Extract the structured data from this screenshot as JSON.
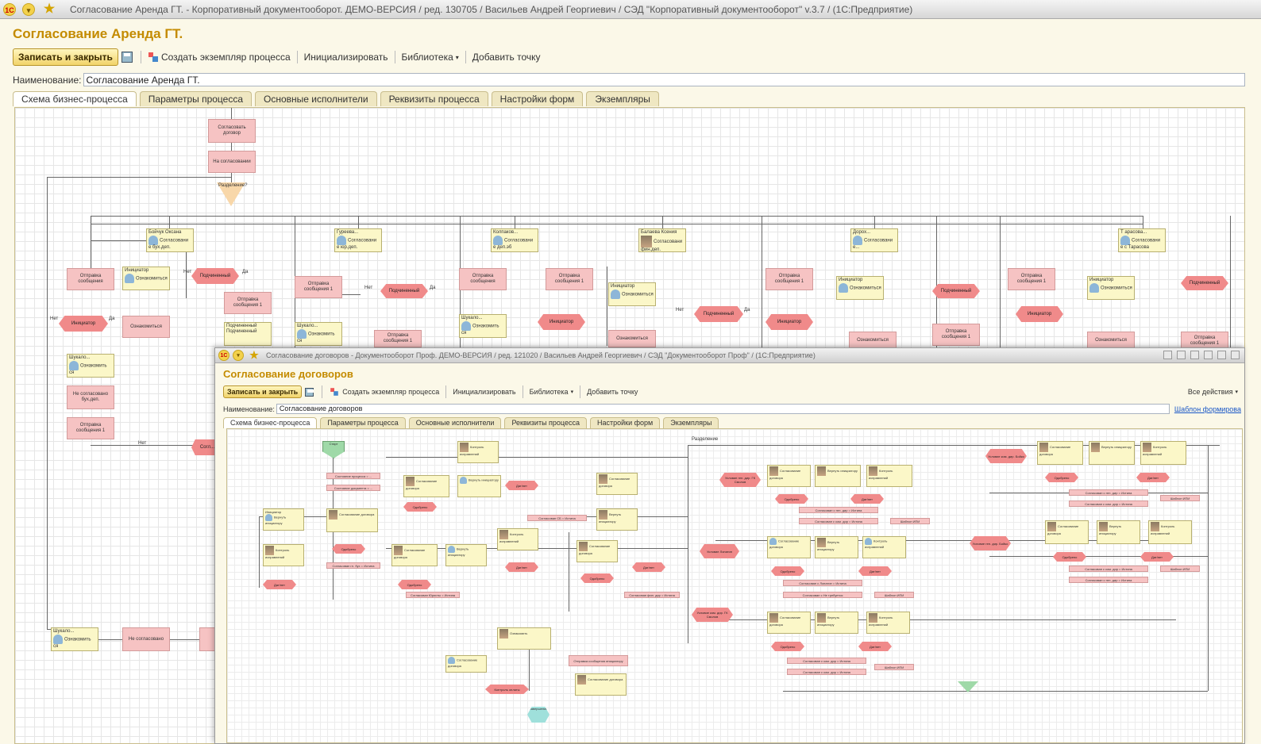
{
  "window": {
    "title": "Согласование Аренда ГТ. - Корпоративный документооборот. ДЕМО-ВЕРСИЯ / ред. 130705 /  Васильев Андрей Георгиевич  /  СЭД \"Корпоративный документооборот\" v.3.7 /  (1С:Предприятие)"
  },
  "form": {
    "title": "Согласование Аренда ГТ.",
    "toolbar": {
      "save_close": "Записать и закрыть",
      "create_instance": "Создать экземпляр процесса",
      "initialize": "Инициализировать",
      "library": "Библиотека",
      "add_point": "Добавить точку"
    },
    "name_label": "Наименование:",
    "name_value": "Согласование Аренда ГТ.",
    "tabs": [
      "Схема бизнес-процесса",
      "Параметры процесса",
      "Основные исполнители",
      "Реквизиты процесса",
      "Настройки форм",
      "Экземпляры"
    ],
    "diagram": {
      "n_top_send": "Согласовать договор",
      "n_on_approval": "На согласовании",
      "n_split": "Разделение?",
      "tasks": [
        "Бойчук Оксана",
        "Гуреева...",
        "Колпаков...",
        "Балаева Ксения",
        "Дорох...",
        "Т арасова...",
        "Инициатор",
        "Шукалова..."
      ],
      "task_sub": [
        "Согласовани е бух.деп.",
        "Согласовани е юр.деп.",
        "Согласовани е деп.эб",
        "Согласовани фин.деп.",
        "Согласовани е...",
        "Согласовани е с Тарасова"
      ],
      "send_msg": "Отправка сообщения",
      "send_msg1": "Отправка сообщения 1",
      "subordinate": "Подчиненный",
      "initiator": "Инициатор",
      "acquaint": "Ознакомиться",
      "yes": "Да",
      "no": "Нет",
      "not_approved_buh": "Не согласовано бух.деп.",
      "not_approved": "Не согласовано",
      "acquaint_bottom": "Ознакомить ся",
      "shukalo": "Шукало...",
      "sog": "Согл..."
    }
  },
  "inner": {
    "title": "Согласование договоров - Документооборот Проф. ДЕМО-ВЕРСИЯ / ред. 121020 /  Васильев Андрей Георгиевич  /  СЭД \"Документооборот Проф\" /  (1С:Предприятие)",
    "form_title": "Согласование договоров",
    "toolbar": {
      "save_close": "Записать и закрыть",
      "create_instance": "Создать экземпляр процесса",
      "initialize": "Инициализировать",
      "library": "Библиотека",
      "add_point": "Добавить точку",
      "all_actions": "Все действия"
    },
    "name_label": "Наименование:",
    "name_value": "Согласование договоров",
    "template_link": "Шаблон формирова",
    "tabs": [
      "Схема бизнес-процесса",
      "Параметры процесса",
      "Основные исполнители",
      "Реквизиты процесса",
      "Настройки форм",
      "Экземпляры"
    ],
    "diagram": {
      "start": "Старт",
      "end": "Завершение",
      "split": "Разделение",
      "state1": "Состояние процесса = ...",
      "state2": "Состояние документа = ...",
      "approved": "Одобрено",
      "rejected": "Дат/нет",
      "approve_sb": "Согласован СБ = Истина",
      "approve_buh": "Согласован гл. бух = Истина",
      "approve_ur": "Согласован Юристы = Истина",
      "approve_fin": "Согласован фин. дир = Истина",
      "approve_gen": "Согласован с ген. дир = Истина",
      "approve_com": "Согласован с ком. дир = Истина",
      "approve_ipp": "Согласован с Лопатин = Истина",
      "approve_np": "Согласован с Не требуется",
      "vip": "Шаблон ИПИ",
      "initiator": "Инициатор",
      "familiar": "Ознакомить",
      "control": "Контроль оплаты",
      "send_init": "Отправка сообщения инициатору",
      "cond_smolov": "Условие ген. дир. ГК Смолов",
      "cond_lopatin": "Условие Лопатин",
      "cond_kom": "Условие ком. дир. ГК Смолов",
      "cond_boyko": "Условие ком. дир. Бойко",
      "cond_gen_boyko": "Условие ген. дир. Бойко",
      "task_approve": "Согласование договора",
      "task_control": "Контроль исправлений",
      "task_return": "Вернуть инициатору",
      "yes": "Да",
      "no": "Нет"
    }
  }
}
